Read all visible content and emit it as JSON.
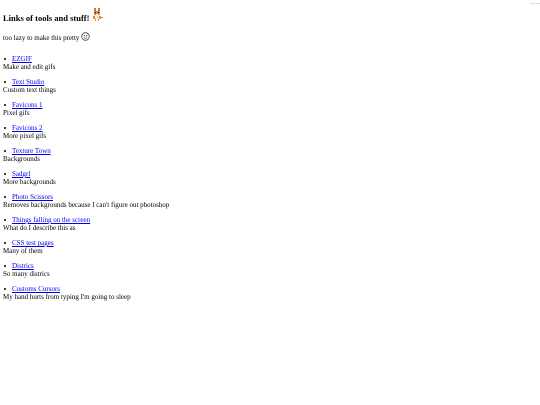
{
  "header": {
    "title": "Links of tools and stuff!",
    "title_icon": "corgi-pixel-icon",
    "subtitle": "too lazy to make this pretty",
    "subtitle_icon": "smiley-face-icon"
  },
  "links": [
    {
      "label": "EZGIF",
      "description": "Make and edit gifs"
    },
    {
      "label": "Text Studio",
      "description": "Custom text things"
    },
    {
      "label": "Favicons 1",
      "description": "Pixel gifs"
    },
    {
      "label": "Favicons 2",
      "description": "More pixel gifs"
    },
    {
      "label": "Texture Town",
      "description": "Backgrounds"
    },
    {
      "label": "Sadgrl",
      "description": "More backgrounds"
    },
    {
      "label": "Photo Scissors",
      "description": "Removes backgrounds because I can't figure out photoshop"
    },
    {
      "label": "Things falling on the screen",
      "description": "What do I describe this as"
    },
    {
      "label": "CSS test pages",
      "description": "Many of them"
    },
    {
      "label": "Districs",
      "description": "So many districs"
    },
    {
      "label": "Customs Cursors",
      "description": "My hand hurts from typing I'm going to sleep"
    }
  ],
  "colors": {
    "link": "#0000ee",
    "text": "#000000",
    "background": "#ffffff"
  }
}
